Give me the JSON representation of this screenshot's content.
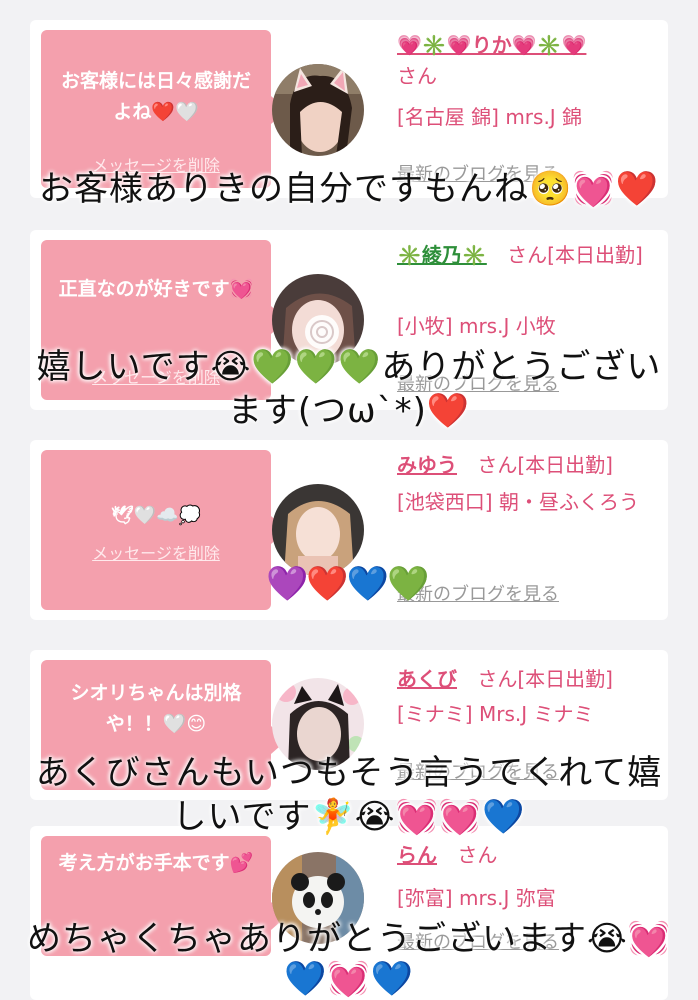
{
  "cards": [
    {
      "message": "お客様には日々感謝だよね❤️🤍",
      "delete_label": "メッセージを削除",
      "name": "💗✳️💗りか💗✳️💗",
      "suffix": "さん",
      "location": "[名古屋 錦] mrs.J 錦",
      "blog_label": "最新のブログを見る"
    },
    {
      "message": "正直なのが好きです💓",
      "delete_label": "メッセージを削除",
      "name": "✳️綾乃✳️",
      "suffix": "さん[本日出勤]",
      "location": "[小牧] mrs.J 小牧",
      "blog_label": "最新のブログを見る"
    },
    {
      "message": "🕊🤍☁️💭",
      "delete_label": "メッセージを削除",
      "name": "みゆう",
      "suffix": "さん[本日出勤]",
      "location": "[池袋西口] 朝・昼ふくろう",
      "blog_label": "最新のブログを見る"
    },
    {
      "message": "シオリちゃんは別格や！！🤍😊",
      "delete_label": "",
      "name": "あくび",
      "suffix": "さん[本日出勤]",
      "location": "[ミナミ] Mrs.J ミナミ",
      "blog_label": "最新のブログを見る"
    },
    {
      "message": "考え方がお手本です💕",
      "delete_label": "",
      "name": "らん",
      "suffix": "さん",
      "location": "[弥富] mrs.J 弥富",
      "blog_label": "最新のブログを見る"
    }
  ],
  "overlays": {
    "o1": "お客様ありきの自分ですもんね🥺💓❤️",
    "o2a": "嬉しいです😭💚💚💚ありがとうござい",
    "o2b": "ます(つω`*)❤️",
    "o3": "💜❤️💙💚",
    "o4a": "あくびさんもいつもそう言うてくれて嬉",
    "o4b": "しいです🧚😭💓💓💙",
    "o5a": "めちゃくちゃありがとうございます😭💓",
    "o5b": "💙💓💙"
  },
  "colors": {
    "accent": "#dd4f78",
    "bubble": "#f4a0ad",
    "background": "#f2f2f4"
  }
}
